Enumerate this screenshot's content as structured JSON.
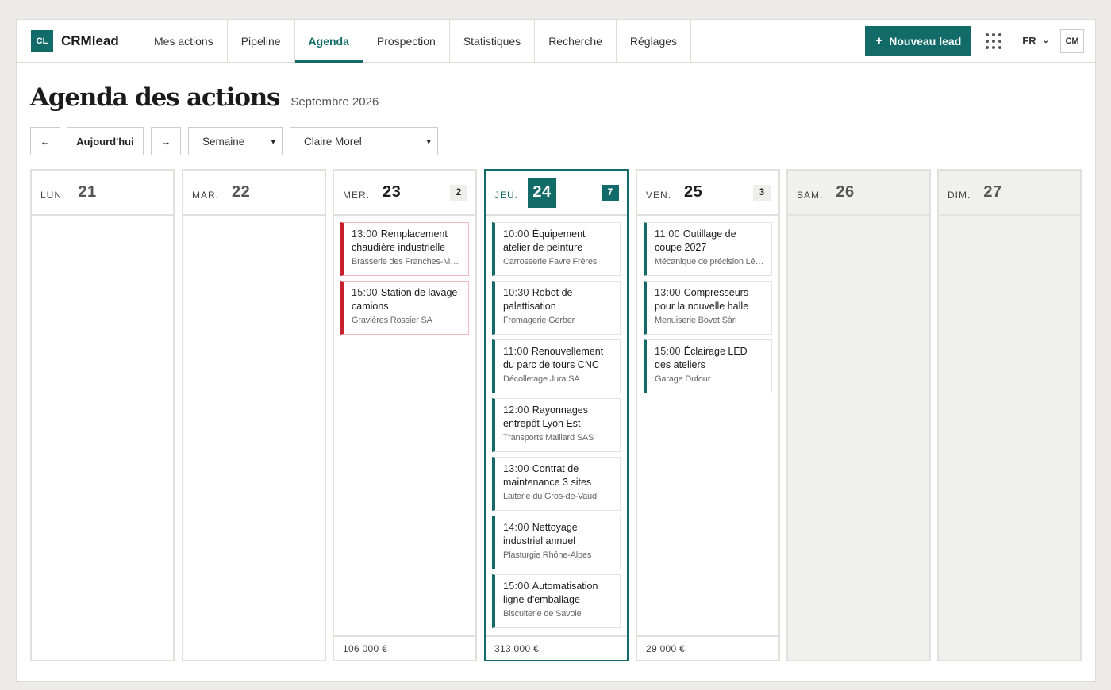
{
  "brand": {
    "logo": "CL",
    "name": "CRMlead"
  },
  "nav": {
    "tabs": [
      {
        "label": "Mes actions"
      },
      {
        "label": "Pipeline"
      },
      {
        "label": "Agenda"
      },
      {
        "label": "Prospection"
      },
      {
        "label": "Statistiques"
      },
      {
        "label": "Recherche"
      },
      {
        "label": "Réglages"
      }
    ],
    "active_tab": "Agenda",
    "new_lead": "Nouveau lead",
    "new_lead_icon": "plus-icon",
    "apps_icon": "grid-dots-icon",
    "language": "FR",
    "avatar": "CM"
  },
  "page": {
    "title": "Agenda des actions",
    "subtitle": "Septembre 2026"
  },
  "toolbar": {
    "prev": "←",
    "today": "Aujourd'hui",
    "next": "→",
    "view": "Semaine",
    "user": "Claire Morel"
  },
  "colors": {
    "accent": "#126b68",
    "overdue": "#c8202f"
  },
  "days": [
    {
      "name": "LUN.",
      "num": "21",
      "count": "",
      "total": "",
      "cards": []
    },
    {
      "name": "MAR.",
      "num": "22",
      "count": "",
      "total": "",
      "cards": []
    },
    {
      "name": "MER.",
      "num": "23",
      "count": "2",
      "total": "106 000 €",
      "cards": [
        {
          "time": "13:00",
          "title": "Remplacement chaudière industrielle",
          "company": "Brasserie des Franches-Montagnes"
        },
        {
          "time": "15:00",
          "title": "Station de lavage camions",
          "company": "Gravières Rossier SA"
        }
      ]
    },
    {
      "name": "JEU.",
      "num": "24",
      "count": "7",
      "total": "313 000 €",
      "cards": [
        {
          "time": "10:00",
          "title": "Équipement atelier de peinture",
          "company": "Carrosserie Favre Frères"
        },
        {
          "time": "10:30",
          "title": "Robot de palettisation",
          "company": "Fromagerie Gerber"
        },
        {
          "time": "11:00",
          "title": "Renouvellement du parc de tours CNC",
          "company": "Décolletage Jura SA"
        },
        {
          "time": "12:00",
          "title": "Rayonnages entrepôt Lyon Est",
          "company": "Transports Maillard SAS"
        },
        {
          "time": "13:00",
          "title": "Contrat de maintenance 3 sites",
          "company": "Laiterie du Gros-de-Vaud"
        },
        {
          "time": "14:00",
          "title": "Nettoyage industriel annuel",
          "company": "Plasturgie Rhône-Alpes"
        },
        {
          "time": "15:00",
          "title": "Automatisation ligne d'emballage",
          "company": "Biscuiterie de Savoie"
        }
      ]
    },
    {
      "name": "VEN.",
      "num": "25",
      "count": "3",
      "total": "29 000 €",
      "cards": [
        {
          "time": "11:00",
          "title": "Outillage de coupe 2027",
          "company": "Mécanique de précision Léman"
        },
        {
          "time": "13:00",
          "title": "Compresseurs pour la nouvelle halle",
          "company": "Menuiserie Bovet Sàrl"
        },
        {
          "time": "15:00",
          "title": "Éclairage LED des ateliers",
          "company": "Garage Dufour"
        }
      ]
    },
    {
      "name": "SAM.",
      "num": "26",
      "count": "",
      "total": "",
      "cards": []
    },
    {
      "name": "DIM.",
      "num": "27",
      "count": "",
      "total": "",
      "cards": []
    }
  ]
}
